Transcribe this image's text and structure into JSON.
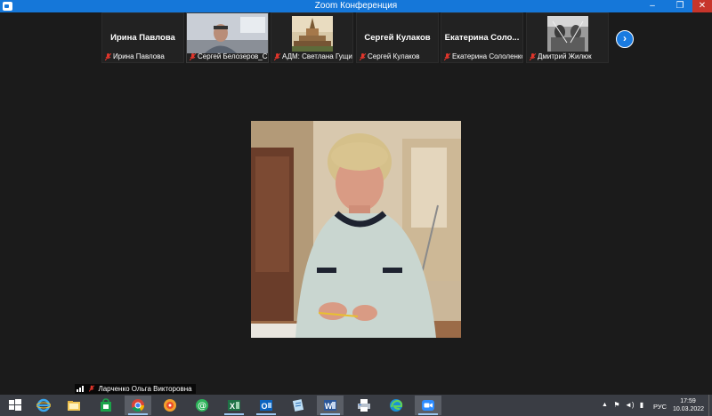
{
  "window": {
    "title": "Zoom Конференция",
    "min": "–",
    "max": "❐",
    "close": "✕"
  },
  "gallery": {
    "tiles": [
      {
        "big_name": "Ирина Павлова",
        "label": "Ирина Павлова",
        "type": "name"
      },
      {
        "big_name": "",
        "label": "Сергей Белозеров_Санкт-Петербург",
        "type": "video"
      },
      {
        "big_name": "",
        "label": "АДМ: Светлана Гущина",
        "type": "image"
      },
      {
        "big_name": "Сергей Кулаков",
        "label": "Сергей Кулаков",
        "type": "name"
      },
      {
        "big_name": "Екатерина  Соло...",
        "label": "Екатерина Сололенко",
        "type": "name"
      },
      {
        "big_name": "",
        "label": "Дмитрий Жилюк",
        "type": "photo"
      }
    ],
    "next_icon": "›"
  },
  "speaker": {
    "name": "Ларченко Ольга Викторовна"
  },
  "taskbar": {
    "apps": [
      "windows-start",
      "internet-explorer",
      "file-explorer",
      "store",
      "chrome",
      "yandex-browser",
      "mail",
      "excel",
      "outlook",
      "notepad",
      "word",
      "printer",
      "edge",
      "zoom"
    ],
    "language": "РУС",
    "time": "17:59",
    "date": "10.03.2022"
  },
  "colors": {
    "titlebar": "#1577d9",
    "taskbar": "#3a3d44",
    "muted_mic": "#e0352b",
    "accent": "#1a7be0"
  }
}
